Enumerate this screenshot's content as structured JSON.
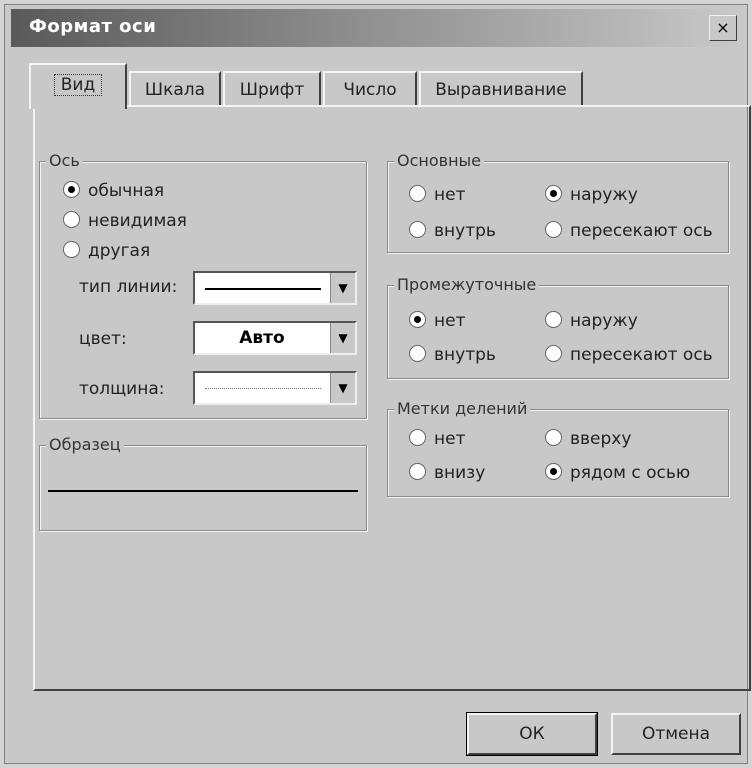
{
  "dialog": {
    "title": "Формат оси",
    "close_label": "×"
  },
  "tabs": [
    {
      "label": "Вид"
    },
    {
      "label": "Шкала"
    },
    {
      "label": "Шрифт"
    },
    {
      "label": "Число"
    },
    {
      "label": "Выравнивание"
    }
  ],
  "axis": {
    "legend": "Ось",
    "options": [
      {
        "label": "обычная",
        "checked": true
      },
      {
        "label": "невидимая",
        "checked": false
      },
      {
        "label": "другая",
        "checked": false
      }
    ],
    "line_type_label": "тип линии:",
    "color_label": "цвет:",
    "color_value": "Авто",
    "weight_label": "толщина:"
  },
  "sample": {
    "legend": "Образец"
  },
  "major": {
    "legend": "Основные",
    "options": [
      {
        "label": "нет",
        "checked": false
      },
      {
        "label": "наружу",
        "checked": true
      },
      {
        "label": "внутрь",
        "checked": false
      },
      {
        "label": "пересекают ось",
        "checked": false
      }
    ]
  },
  "minor": {
    "legend": "Промежуточные",
    "options": [
      {
        "label": "нет",
        "checked": true
      },
      {
        "label": "наружу",
        "checked": false
      },
      {
        "label": "внутрь",
        "checked": false
      },
      {
        "label": "пересекают ось",
        "checked": false
      }
    ]
  },
  "tick_labels": {
    "legend": "Метки делений",
    "options": [
      {
        "label": "нет",
        "checked": false
      },
      {
        "label": "вверху",
        "checked": false
      },
      {
        "label": "внизу",
        "checked": false
      },
      {
        "label": "рядом с осью",
        "checked": true
      }
    ]
  },
  "buttons": {
    "ok": "ОК",
    "cancel": "Отмена"
  }
}
